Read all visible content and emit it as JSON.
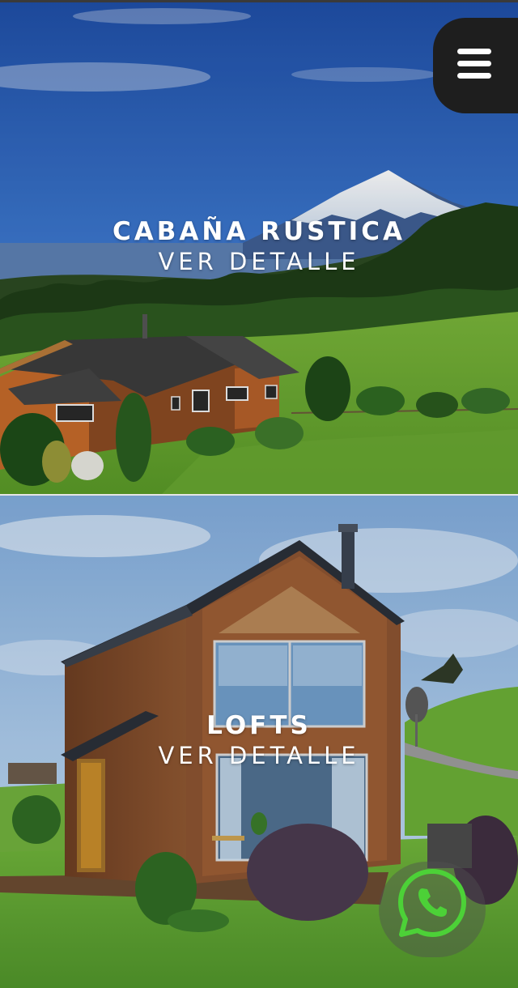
{
  "menu": {
    "icon": "hamburger-icon",
    "background": "#1e1e1e"
  },
  "cards": [
    {
      "title": "CABAÑA RUSTICA",
      "link_label": "VER DETALLE"
    },
    {
      "title": "LOFTS",
      "link_label": "VER DETALLE"
    }
  ],
  "whatsapp": {
    "icon": "whatsapp-icon",
    "color": "#4cd137"
  }
}
